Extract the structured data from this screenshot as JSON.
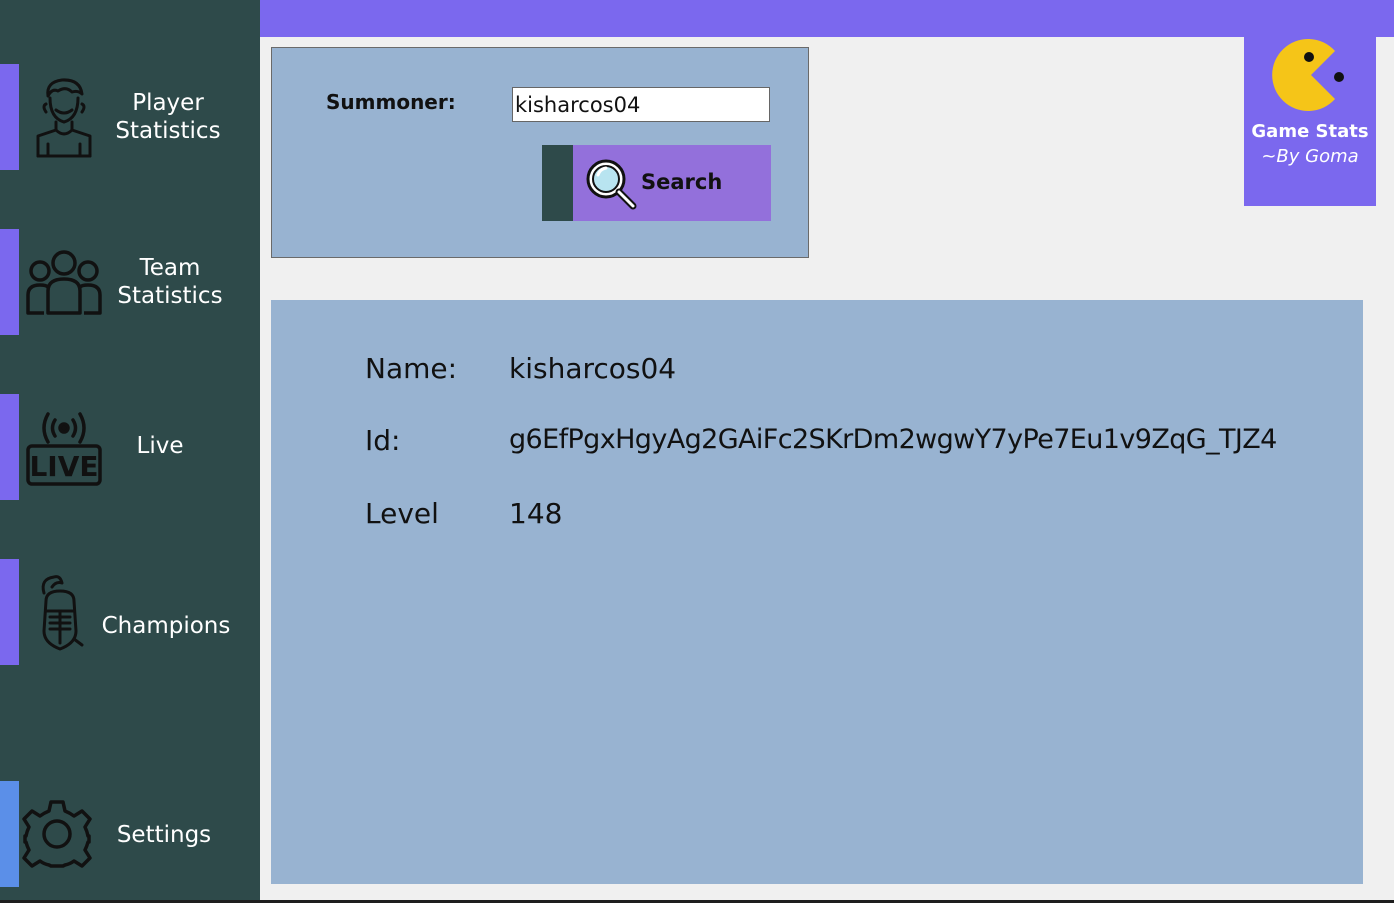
{
  "sidebar": {
    "items": [
      {
        "label": "Player\nStatistics",
        "icon": "player-icon"
      },
      {
        "label": "Team\nStatistics",
        "icon": "team-icon"
      },
      {
        "label": "Live",
        "icon": "live-icon"
      },
      {
        "label": "Champions",
        "icon": "knight-helmet-icon"
      },
      {
        "label": "Settings",
        "icon": "gear-icon"
      }
    ]
  },
  "logo": {
    "title": "Game Stats",
    "subtitle": "~By Goma",
    "icon": "pacman-icon"
  },
  "search": {
    "label": "Summoner:",
    "input_value": "kisharcos04",
    "button_label": "Search",
    "button_icon": "magnifier-icon"
  },
  "info": {
    "name_label": "Name:",
    "name_value": "kisharcos04",
    "id_label": "Id:",
    "id_value": "g6EfPgxHgyAg2GAiFc2SKrDm2wgwY7yPe7Eu1v9ZqG_TJZ4",
    "level_label": "Level",
    "level_value": "148"
  },
  "colors": {
    "sidebar_bg": "#2e4a4a",
    "accent": "#7b68ee",
    "accent_blue": "#5b8fe8",
    "panel_bg": "#98b3d1",
    "button_bg": "#9370db",
    "pacman": "#f5c518"
  }
}
